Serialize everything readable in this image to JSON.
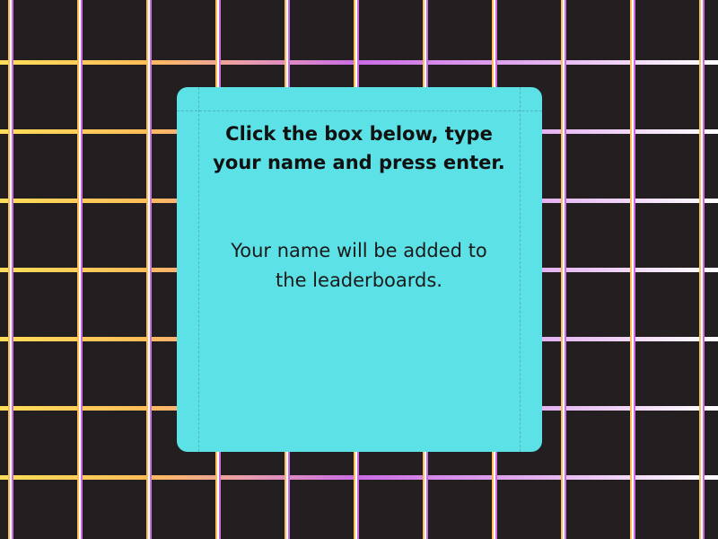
{
  "colors": {
    "background": "#231f20",
    "card": "#5ce1e6",
    "text": "#111111",
    "grid_gradient": [
      "#ffde59",
      "#ffbd59",
      "#e89ab0",
      "#cb6ce6",
      "#e3b0f0",
      "#ffffff"
    ],
    "grid_vertical": [
      "#ffffff",
      "#ffbd59",
      "#cb6ce6"
    ]
  },
  "dialog": {
    "instruction_lines": [
      "Click the box below, type",
      "your name and press enter."
    ],
    "info_lines": [
      "Your name will be added to",
      "the leaderboards."
    ]
  },
  "name_input": {
    "value": ""
  }
}
